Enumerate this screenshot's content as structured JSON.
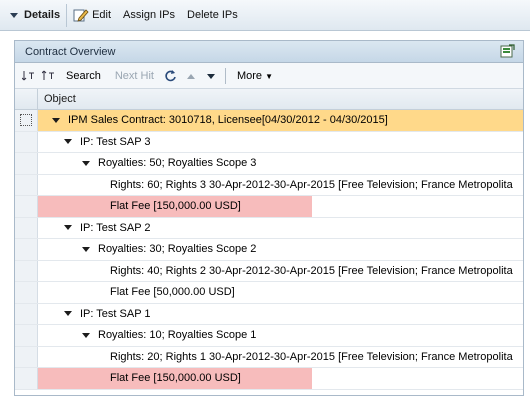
{
  "toolbar": {
    "details_label": "Details",
    "edit_label": "Edit",
    "assign_label": "Assign IPs",
    "delete_label": "Delete IPs"
  },
  "panel": {
    "title": "Contract Overview",
    "grid_toolbar": {
      "search_label": "Search",
      "next_hit_label": "Next Hit",
      "more_label": "More"
    },
    "column_header": "Object",
    "rows": [
      {
        "text": "IPM Sales Contract:  3010718, Licensee[04/30/2012 - 04/30/2015]",
        "level": 0,
        "expanded": true,
        "highlight": "selected",
        "has_checkbox": true
      },
      {
        "text": "IP: Test SAP 3",
        "level": 1,
        "expanded": true
      },
      {
        "text": "Royalties: 50;  Royalties Scope 3",
        "level": 2,
        "expanded": true
      },
      {
        "text": "Rights: 60;  Rights 3   30-Apr-2012-30-Apr-2015 [Free Television; France Metropolita",
        "level": 3
      },
      {
        "text": "Flat Fee [150,000.00 USD]",
        "level": 3,
        "highlight": "error"
      },
      {
        "text": "IP: Test SAP 2",
        "level": 1,
        "expanded": true
      },
      {
        "text": "Royalties: 30;  Royalties Scope 2",
        "level": 2,
        "expanded": true
      },
      {
        "text": "Rights: 40;   Rights 2  30-Apr-2012-30-Apr-2015 [Free Television; France Metropolita",
        "level": 3
      },
      {
        "text": "Flat Fee [50,000.00 USD]",
        "level": 3
      },
      {
        "text": "IP: Test SAP 1",
        "level": 1,
        "expanded": true
      },
      {
        "text": "Royalties: 10;  Royalties Scope 1",
        "level": 2,
        "expanded": true
      },
      {
        "text": "Rights: 20;  Rights 1   30-Apr-2012-30-Apr-2015 [Free Television; France Metropolita",
        "level": 3
      },
      {
        "text": "Flat Fee [150,000.00 USD]",
        "level": 3,
        "highlight": "error"
      }
    ]
  },
  "colors": {
    "selected_row": "#ffd98a",
    "error_row": "#f7bcbc",
    "toolbar_bg": "#dfe8f0",
    "panel_header_bg": "#c5d7e7"
  }
}
